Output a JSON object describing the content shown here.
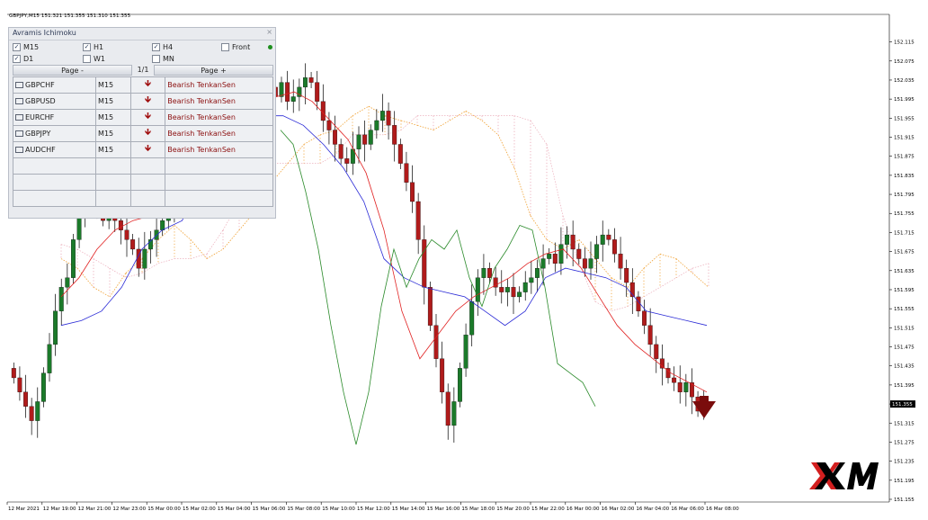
{
  "chart_title": "GBPJPY,M15  151.321 151.355 151.310 151.355",
  "panel": {
    "title": "Avramis Ichimoku",
    "close": "×",
    "timeframes": [
      {
        "label": "M15",
        "checked": true
      },
      {
        "label": "H1",
        "checked": true
      },
      {
        "label": "H4",
        "checked": true
      },
      {
        "label": "Front",
        "checked": false
      },
      {
        "label": "D1",
        "checked": true
      },
      {
        "label": "W1",
        "checked": false
      },
      {
        "label": "MN",
        "checked": false
      }
    ],
    "page_prev": "Page -",
    "page_num": "1/1",
    "page_next": "Page +",
    "rows": [
      {
        "symbol": "GBPCHF",
        "tf": "M15",
        "arrow": "🡻",
        "signal": "Bearish TenkanSen"
      },
      {
        "symbol": "GBPUSD",
        "tf": "M15",
        "arrow": "🡻",
        "signal": "Bearish TenkanSen"
      },
      {
        "symbol": "EURCHF",
        "tf": "M15",
        "arrow": "🡻",
        "signal": "Bearish TenkanSen"
      },
      {
        "symbol": "GBPJPY",
        "tf": "M15",
        "arrow": "🡻",
        "signal": "Bearish TenkanSen"
      },
      {
        "symbol": "AUDCHF",
        "tf": "M15",
        "arrow": "🡻",
        "signal": "Bearish TenkanSen"
      }
    ],
    "empty_rows": 3
  },
  "logo_text": "XM",
  "colors": {
    "bull": "#1b7a2a",
    "bear": "#b01b1b",
    "tenkan": "#e02020",
    "kijun": "#2a2ad6",
    "chikou": "#2a8a2a",
    "cloud_up": "#f0a030",
    "cloud_dn": "#e8a0b0",
    "current_price_bg": "#000000",
    "arrow": "#7a0c0c"
  },
  "chart_data": {
    "type": "candlestick",
    "title": "GBPJPY,M15",
    "ylim": [
      151.155,
      152.135
    ],
    "y_ticks": [
      "152.115",
      "152.075",
      "152.035",
      "151.995",
      "151.955",
      "151.915",
      "151.875",
      "151.835",
      "151.795",
      "151.755",
      "151.715",
      "151.675",
      "151.635",
      "151.595",
      "151.555",
      "151.515",
      "151.475",
      "151.435",
      "151.395",
      "151.355",
      "151.315",
      "151.275",
      "151.235",
      "151.195",
      "151.155"
    ],
    "current_price": "151.355",
    "x_ticks": [
      "12 Mar 2021",
      "12 Mar 19:00",
      "12 Mar 21:00",
      "12 Mar 23:00",
      "15 Mar 00:00",
      "15 Mar 02:00",
      "15 Mar 04:00",
      "15 Mar 06:00",
      "15 Mar 08:00",
      "15 Mar 10:00",
      "15 Mar 12:00",
      "15 Mar 14:00",
      "15 Mar 16:00",
      "15 Mar 18:00",
      "15 Mar 20:00",
      "15 Mar 22:00",
      "16 Mar 00:00",
      "16 Mar 02:00",
      "16 Mar 04:00",
      "16 Mar 06:00",
      "16 Mar 08:00"
    ],
    "candles_close": [
      151.41,
      151.38,
      151.35,
      151.32,
      151.36,
      151.42,
      151.48,
      151.55,
      151.6,
      151.62,
      151.7,
      151.75,
      151.78,
      151.8,
      151.78,
      151.74,
      151.76,
      151.74,
      151.72,
      151.7,
      151.68,
      151.64,
      151.68,
      151.7,
      151.72,
      151.74,
      151.76,
      151.8,
      151.84,
      151.88,
      151.92,
      151.94,
      151.96,
      151.98,
      151.99,
      151.97,
      151.95,
      151.96,
      151.98,
      152.02,
      152.04,
      152.06,
      152.05,
      152.02,
      152.0,
      152.03,
      151.99,
      152.0,
      152.02,
      152.04,
      152.03,
      151.99,
      151.95,
      151.93,
      151.9,
      151.87,
      151.86,
      151.89,
      151.92,
      151.9,
      151.93,
      151.95,
      151.97,
      151.94,
      151.9,
      151.86,
      151.82,
      151.78,
      151.7,
      151.6,
      151.52,
      151.45,
      151.38,
      151.31,
      151.36,
      151.43,
      151.5,
      151.57,
      151.62,
      151.64,
      151.62,
      151.6,
      151.59,
      151.6,
      151.58,
      151.59,
      151.61,
      151.62,
      151.64,
      151.66,
      151.67,
      151.65,
      151.69,
      151.71,
      151.68,
      151.66,
      151.64,
      151.66,
      151.69,
      151.71,
      151.7,
      151.67,
      151.64,
      151.61,
      151.58,
      151.55,
      151.52,
      151.48,
      151.45,
      151.43,
      151.41,
      151.4,
      151.38,
      151.4,
      151.37,
      151.34,
      151.36
    ],
    "series": [
      {
        "name": "Tenkan-sen",
        "values": [
          151.58,
          151.62,
          151.68,
          151.72,
          151.74,
          151.75,
          151.76,
          151.78,
          151.82,
          151.88,
          151.94,
          151.98,
          152.0,
          152.01,
          151.99,
          151.95,
          151.91,
          151.84,
          151.72,
          151.55,
          151.45,
          151.5,
          151.55,
          151.58,
          151.6,
          151.62,
          151.65,
          151.67,
          151.68,
          151.64,
          151.58,
          151.52,
          151.48,
          151.45,
          151.42,
          151.4,
          151.38
        ]
      },
      {
        "name": "Kijun-sen",
        "values": [
          151.52,
          151.53,
          151.55,
          151.6,
          151.68,
          151.72,
          151.74,
          151.84,
          151.9,
          151.95,
          151.96,
          151.96,
          151.94,
          151.9,
          151.85,
          151.78,
          151.66,
          151.62,
          151.6,
          151.59,
          151.58,
          151.55,
          151.52,
          151.55,
          151.62,
          151.64,
          151.63,
          151.62,
          151.6,
          151.55,
          151.54,
          151.53,
          151.52
        ]
      },
      {
        "name": "Chikou",
        "values": [
          151.93,
          151.9,
          151.8,
          151.68,
          151.52,
          151.38,
          151.27,
          151.38,
          151.56,
          151.68,
          151.6,
          151.66,
          151.7,
          151.68,
          151.72,
          151.62,
          151.56,
          151.64,
          151.68,
          151.73,
          151.72,
          151.6,
          151.44,
          151.42,
          151.4,
          151.35
        ]
      }
    ]
  }
}
